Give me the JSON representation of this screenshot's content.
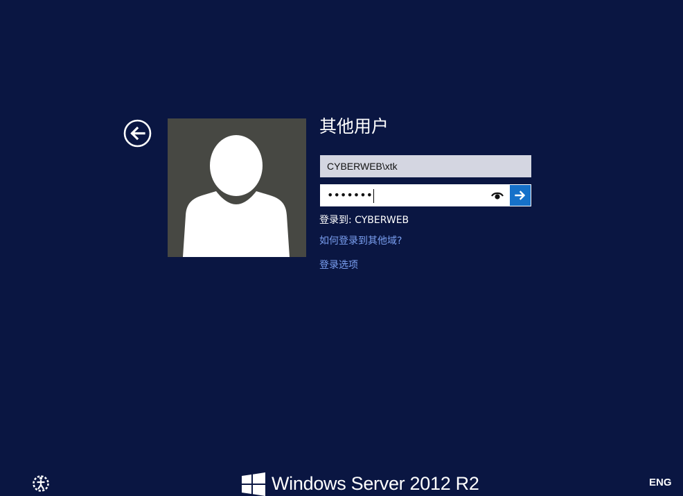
{
  "user": {
    "display_name": "其他用户",
    "username_value": "CYBERWEB\\xtk",
    "password_mask": "•••••••"
  },
  "signin": {
    "domain_prefix": "登录到: ",
    "domain_name": "CYBERWEB",
    "other_domain_link": "如何登录到其他域?",
    "options_link": "登录选项"
  },
  "footer": {
    "brand_text": "Windows Server 2012 R2",
    "language": "ENG"
  },
  "icons": {
    "back": "back-arrow-icon",
    "reveal": "eye-icon",
    "submit": "arrow-right-icon",
    "ease": "ease-of-access-icon",
    "logo": "windows-logo-icon"
  },
  "colors": {
    "background": "#0a1642",
    "avatar_bg": "#474843",
    "submit_blue": "#1671c9",
    "link_blue": "#7a9ff0",
    "field_gray": "#d4d6e1"
  }
}
